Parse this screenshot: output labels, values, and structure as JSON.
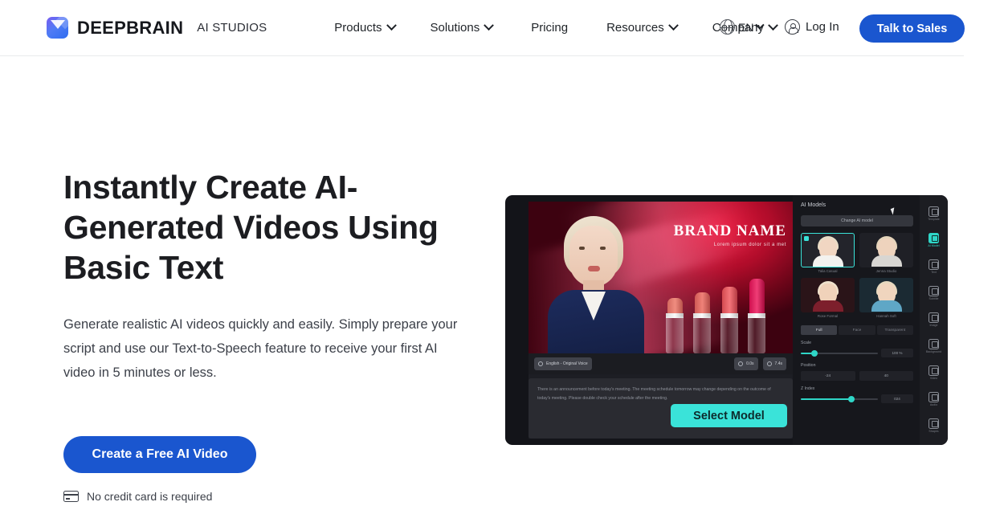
{
  "header": {
    "logo_icon": "deepbrain-cube-logo",
    "brand_main": "DEEPBRAIN",
    "brand_sub": "AI STUDIOS",
    "nav": [
      {
        "label": "Products",
        "has_chevron": true
      },
      {
        "label": "Solutions",
        "has_chevron": true
      },
      {
        "label": "Pricing",
        "has_chevron": false
      },
      {
        "label": "Resources",
        "has_chevron": true
      },
      {
        "label": "Company",
        "has_chevron": true
      }
    ],
    "language": {
      "icon": "globe-icon",
      "code": "EN"
    },
    "login": {
      "icon": "user-circle-icon",
      "label": "Log In"
    },
    "cta": {
      "label": "Talk to Sales",
      "color": "#1a56cf"
    }
  },
  "hero": {
    "headline": "Instantly Create AI-Generated Videos Using Basic Text",
    "subhead": "Generate realistic AI videos quickly and easily. Simply prepare your script and use our Text-to-Speech feature to receive your first AI video in 5 minutes or less.",
    "cta_label": "Create a Free AI Video",
    "note": {
      "icon": "credit-card-icon",
      "text": "No credit card is required"
    }
  },
  "preview": {
    "video": {
      "brand_name": "BRAND NAME",
      "brand_tagline": "Lorem ipsum dolor sit a met"
    },
    "toolbar": {
      "language_chip": "English - Original Voice",
      "duration_chip": "0.0s",
      "total_chip": "7.4s"
    },
    "script_text": "There is an announcement before today's meeting. The meeting schedule tomorrow may change depending on the outcome of today's meeting. Please double check your schedule after the meeting.",
    "select_model_button": "Select Model",
    "panel": {
      "title": "AI Models",
      "change_model_button": "Change AI model",
      "models": [
        {
          "name": "Talia Casual",
          "selected": true,
          "hair": "#e9dcc6",
          "skin": "#f1d6c2",
          "top": "#f3f2ef",
          "bg": "#23242b"
        },
        {
          "name": "Jenna Studio",
          "selected": false,
          "hair": "#e4d4ba",
          "skin": "#eed3bd",
          "top": "#d8d6d2",
          "bg": "#1f2026"
        },
        {
          "name": "Rose Formal",
          "selected": false,
          "hair": "#efe2cd",
          "skin": "#f0d2ba",
          "top": "#7d1f2c",
          "bg": "#2a1418"
        },
        {
          "name": "Hannah Soft",
          "selected": false,
          "hair": "#e7d9bf",
          "skin": "#f0d5be",
          "top": "#5fa7c6",
          "bg": "#1b2a33"
        }
      ],
      "segments": [
        {
          "label": "Full",
          "active": true
        },
        {
          "label": "Face",
          "active": false
        },
        {
          "label": "Transparent",
          "active": false
        }
      ],
      "controls": [
        {
          "label": "Scale",
          "value": "100 %",
          "fill_pct": 18
        },
        {
          "label": "Z Index",
          "value": "024",
          "fill_pct": 66
        }
      ],
      "position": {
        "label": "Position",
        "x": "-24",
        "y": "40"
      }
    },
    "rail": [
      {
        "label": "Template",
        "active": false
      },
      {
        "label": "AI Model",
        "active": true
      },
      {
        "label": "Text",
        "active": false
      },
      {
        "label": "Subtitle",
        "active": false
      },
      {
        "label": "Image",
        "active": false
      },
      {
        "label": "Background",
        "active": false
      },
      {
        "label": "Video",
        "active": false
      },
      {
        "label": "Audio",
        "active": false
      },
      {
        "label": "Shapes",
        "active": false
      }
    ],
    "cursor_icon": "mouse-pointer-icon"
  }
}
